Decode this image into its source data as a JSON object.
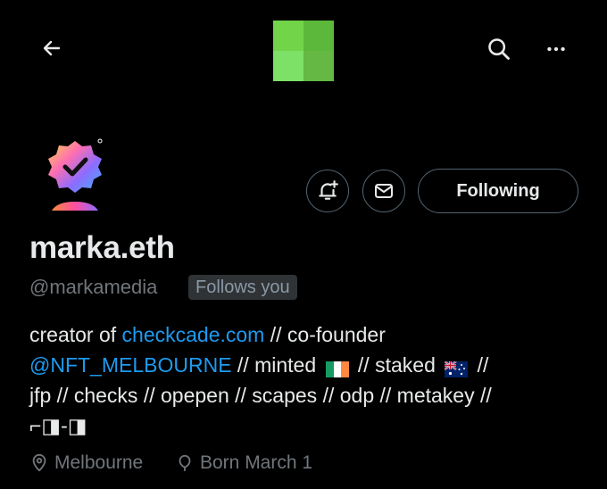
{
  "header": {
    "back_icon": "arrow-left-icon",
    "search_icon": "search-icon",
    "more_icon": "more-horizontal-icon",
    "logo_colors": [
      "#71d449",
      "#5cb83a",
      "#7de067",
      "#64b843"
    ]
  },
  "actions": {
    "notify_icon": "bell-plus-icon",
    "message_icon": "mail-icon",
    "following_label": "Following"
  },
  "profile": {
    "name": "marka.eth",
    "handle": "@markamedia",
    "follows_you": "Follows you"
  },
  "bio": {
    "line1_prefix": "creator of ",
    "line1_link": "checkcade.com",
    "line1_suffix": " // co-founder",
    "line2_mention": "@NFT_MELBOURNE",
    "line2_a": " // minted ",
    "line2_b": " // staked ",
    "line2_c": " //",
    "line3": "jfp // checks // opepen // scapes // odp // metakey //",
    "line4": "⌐◨-◨"
  },
  "meta": {
    "location": "Melbourne",
    "birthday": "Born March 1"
  },
  "colors": {
    "accent": "#1d9bf0",
    "muted": "#71767b",
    "border": "#536471"
  }
}
